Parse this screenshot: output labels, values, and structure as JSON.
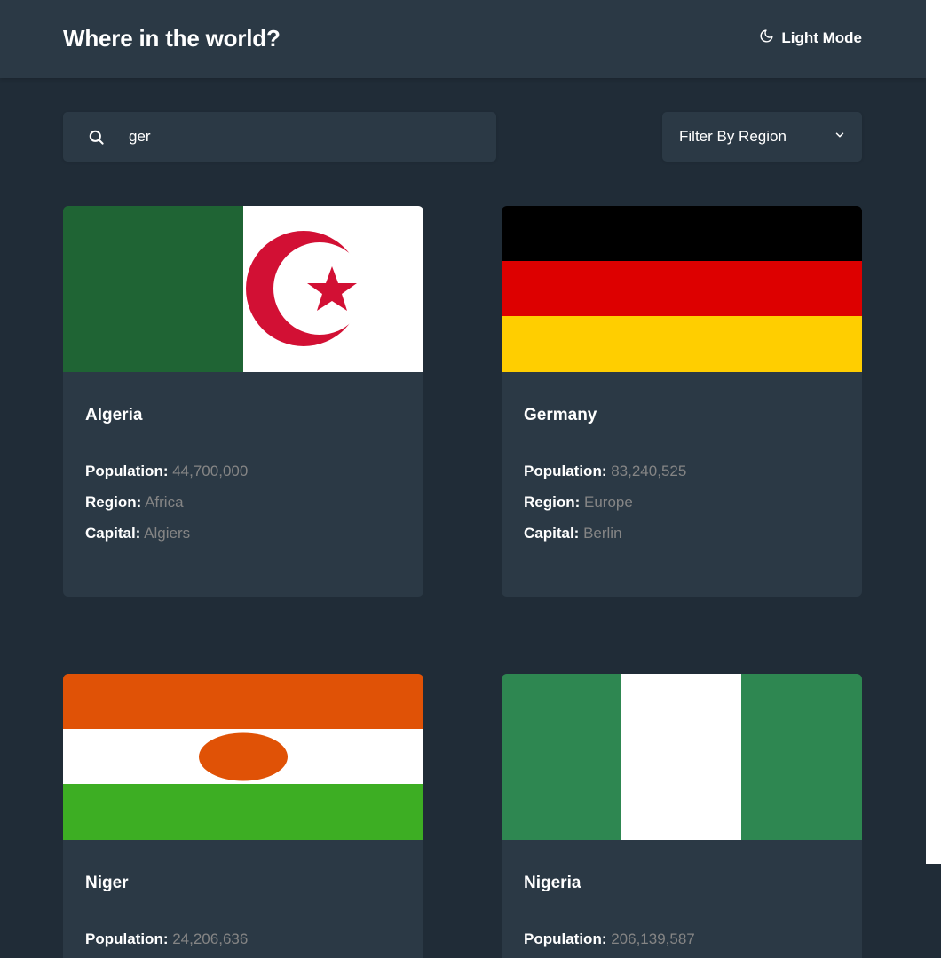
{
  "header": {
    "title": "Where in the world?",
    "mode_label": "Light Mode"
  },
  "search": {
    "value": "ger",
    "icon": "search-icon"
  },
  "filter": {
    "label": "Filter By Region",
    "icon": "chevron-down-icon"
  },
  "labels": {
    "population": "Population:",
    "region": "Region:",
    "capital": "Capital:"
  },
  "countries": [
    {
      "name": "Algeria",
      "population": "44,700,000",
      "region": "Africa",
      "capital": "Algiers"
    },
    {
      "name": "Germany",
      "population": "83,240,525",
      "region": "Europe",
      "capital": "Berlin"
    },
    {
      "name": "Niger",
      "population": "24,206,636",
      "region": "",
      "capital": ""
    },
    {
      "name": "Nigeria",
      "population": "206,139,587",
      "region": "",
      "capital": ""
    }
  ],
  "colors": {
    "background": "#202c37",
    "element": "#2b3945",
    "text": "#ffffff",
    "muted": "#858585"
  }
}
